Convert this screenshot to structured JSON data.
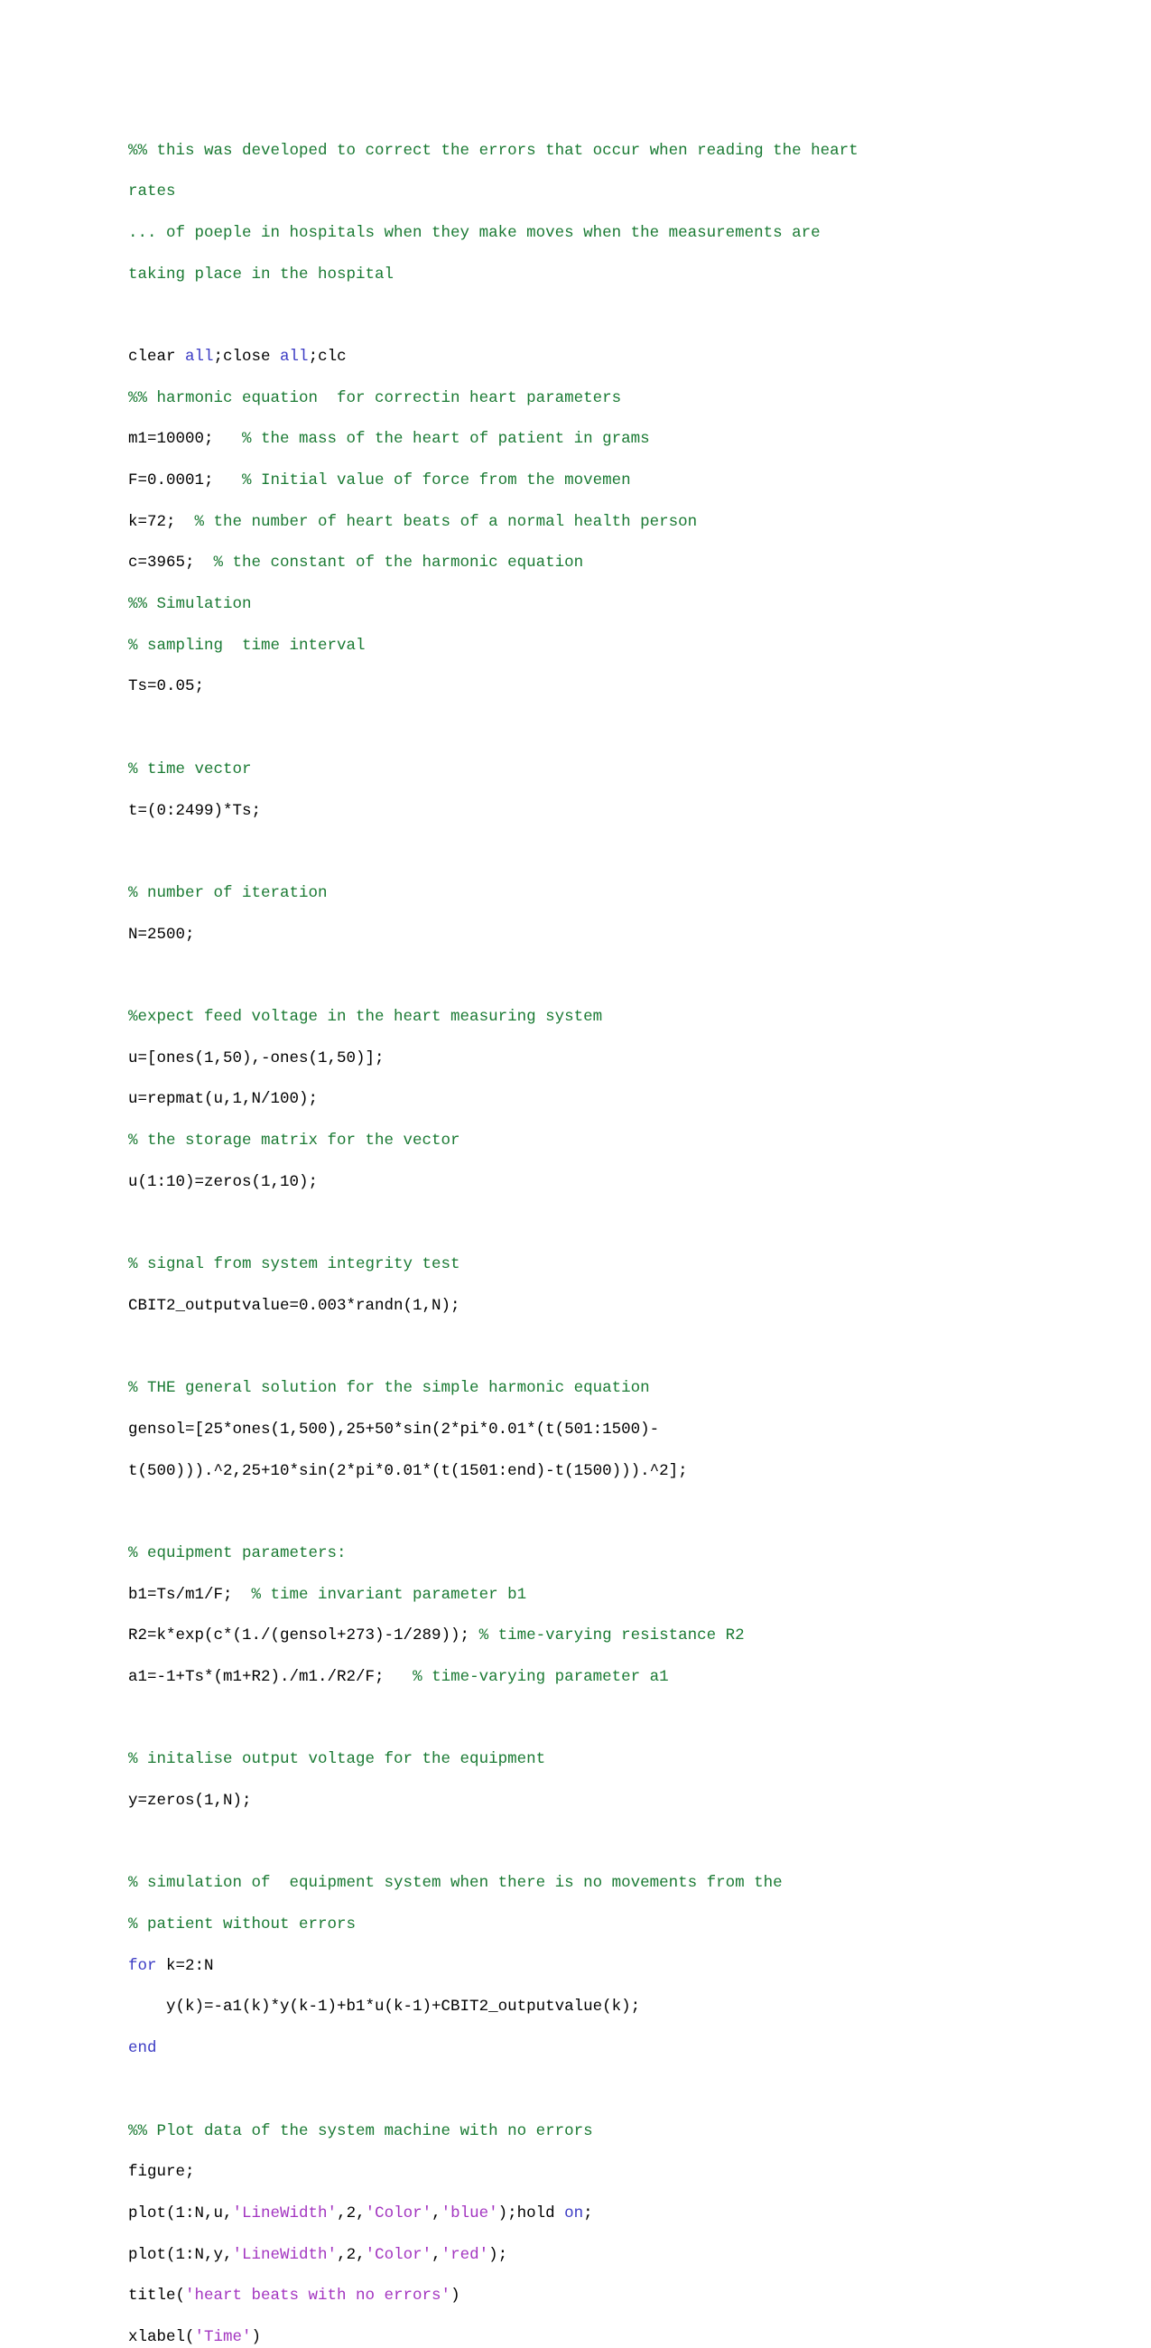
{
  "document": {
    "type": "matlab-source-listing",
    "language": "MATLAB",
    "colors": {
      "background": "#ffffff",
      "plain_text": "#000000",
      "comment": "#1a7a33",
      "keyword": "#3b3bc4",
      "string": "#a335c0"
    }
  },
  "code": {
    "lines": [
      {
        "id": "l1",
        "segments": [
          {
            "cls": "cmt",
            "t": "%% this was developed to correct the errors that occur when reading the heart"
          }
        ]
      },
      {
        "id": "l2",
        "segments": [
          {
            "cls": "cmt",
            "t": "rates"
          }
        ]
      },
      {
        "id": "l3",
        "segments": [
          {
            "cls": "cmt",
            "t": "... of poeple in hospitals when they make moves when the measurements are"
          }
        ]
      },
      {
        "id": "l4",
        "segments": [
          {
            "cls": "cmt",
            "t": "taking place in the hospital"
          }
        ]
      },
      {
        "id": "l5",
        "segments": [
          {
            "cls": "pln",
            "t": ""
          }
        ]
      },
      {
        "id": "l6",
        "segments": [
          {
            "cls": "pln",
            "t": "clear "
          },
          {
            "cls": "kw",
            "t": "all"
          },
          {
            "cls": "pln",
            "t": ";close "
          },
          {
            "cls": "kw",
            "t": "all"
          },
          {
            "cls": "pln",
            "t": ";clc"
          }
        ]
      },
      {
        "id": "l7",
        "segments": [
          {
            "cls": "cmt",
            "t": "%% harmonic equation  for correctin heart parameters"
          }
        ]
      },
      {
        "id": "l8",
        "segments": [
          {
            "cls": "pln",
            "t": "m1=10000;   "
          },
          {
            "cls": "cmt",
            "t": "% the mass of the heart of patient in grams"
          }
        ]
      },
      {
        "id": "l9",
        "segments": [
          {
            "cls": "pln",
            "t": "F=0.0001;   "
          },
          {
            "cls": "cmt",
            "t": "% Initial value of force from the movemen"
          }
        ]
      },
      {
        "id": "l10",
        "segments": [
          {
            "cls": "pln",
            "t": "k=72;  "
          },
          {
            "cls": "cmt",
            "t": "% the number of heart beats of a normal health person"
          }
        ]
      },
      {
        "id": "l11",
        "segments": [
          {
            "cls": "pln",
            "t": "c=3965;  "
          },
          {
            "cls": "cmt",
            "t": "% the constant of the harmonic equation"
          }
        ]
      },
      {
        "id": "l12",
        "segments": [
          {
            "cls": "cmt",
            "t": "%% Simulation"
          }
        ]
      },
      {
        "id": "l13",
        "segments": [
          {
            "cls": "cmt",
            "t": "% sampling  time interval"
          }
        ]
      },
      {
        "id": "l14",
        "segments": [
          {
            "cls": "pln",
            "t": "Ts=0.05;"
          }
        ]
      },
      {
        "id": "l15",
        "segments": [
          {
            "cls": "pln",
            "t": ""
          }
        ]
      },
      {
        "id": "l16",
        "segments": [
          {
            "cls": "cmt",
            "t": "% time vector"
          }
        ]
      },
      {
        "id": "l17",
        "segments": [
          {
            "cls": "pln",
            "t": "t=(0:2499)*Ts;"
          }
        ]
      },
      {
        "id": "l18",
        "segments": [
          {
            "cls": "pln",
            "t": ""
          }
        ]
      },
      {
        "id": "l19",
        "segments": [
          {
            "cls": "cmt",
            "t": "% number of iteration"
          }
        ]
      },
      {
        "id": "l20",
        "segments": [
          {
            "cls": "pln",
            "t": "N=2500;"
          }
        ]
      },
      {
        "id": "l21",
        "segments": [
          {
            "cls": "pln",
            "t": ""
          }
        ]
      },
      {
        "id": "l22",
        "segments": [
          {
            "cls": "cmt",
            "t": "%expect feed voltage in the heart measuring system"
          }
        ]
      },
      {
        "id": "l23",
        "segments": [
          {
            "cls": "pln",
            "t": "u=[ones(1,50),-ones(1,50)];"
          }
        ]
      },
      {
        "id": "l24",
        "segments": [
          {
            "cls": "pln",
            "t": "u=repmat(u,1,N/100);"
          }
        ]
      },
      {
        "id": "l25",
        "segments": [
          {
            "cls": "cmt",
            "t": "% the storage matrix for the vector"
          }
        ]
      },
      {
        "id": "l26",
        "segments": [
          {
            "cls": "pln",
            "t": "u(1:10)=zeros(1,10);"
          }
        ]
      },
      {
        "id": "l27",
        "segments": [
          {
            "cls": "pln",
            "t": ""
          }
        ]
      },
      {
        "id": "l28",
        "segments": [
          {
            "cls": "cmt",
            "t": "% signal from system integrity test"
          }
        ]
      },
      {
        "id": "l29",
        "segments": [
          {
            "cls": "pln",
            "t": "CBIT2_outputvalue=0.003*randn(1,N);"
          }
        ]
      },
      {
        "id": "l30",
        "segments": [
          {
            "cls": "pln",
            "t": ""
          }
        ]
      },
      {
        "id": "l31",
        "segments": [
          {
            "cls": "cmt",
            "t": "% THE general solution for the simple harmonic equation"
          }
        ]
      },
      {
        "id": "l32",
        "segments": [
          {
            "cls": "pln",
            "t": "gensol=[25*ones(1,500),25+50*sin(2*pi*0.01*(t(501:1500)-"
          }
        ]
      },
      {
        "id": "l33",
        "segments": [
          {
            "cls": "pln",
            "t": "t(500))).^2,25+10*sin(2*pi*0.01*(t(1501:end)-t(1500))).^2];"
          }
        ]
      },
      {
        "id": "l34",
        "segments": [
          {
            "cls": "pln",
            "t": ""
          }
        ]
      },
      {
        "id": "l35",
        "segments": [
          {
            "cls": "cmt",
            "t": "% equipment parameters:"
          }
        ]
      },
      {
        "id": "l36",
        "segments": [
          {
            "cls": "pln",
            "t": "b1=Ts/m1/F;  "
          },
          {
            "cls": "cmt",
            "t": "% time invariant parameter b1"
          }
        ]
      },
      {
        "id": "l37",
        "segments": [
          {
            "cls": "pln",
            "t": "R2=k*exp(c*(1./(gensol+273)-1/289)); "
          },
          {
            "cls": "cmt",
            "t": "% time-varying resistance R2"
          }
        ]
      },
      {
        "id": "l38",
        "segments": [
          {
            "cls": "pln",
            "t": "a1=-1+Ts*(m1+R2)./m1./R2/F;   "
          },
          {
            "cls": "cmt",
            "t": "% time-varying parameter a1"
          }
        ]
      },
      {
        "id": "l39",
        "segments": [
          {
            "cls": "pln",
            "t": ""
          }
        ]
      },
      {
        "id": "l40",
        "segments": [
          {
            "cls": "cmt",
            "t": "% initalise output voltage for the equipment"
          }
        ]
      },
      {
        "id": "l41",
        "segments": [
          {
            "cls": "pln",
            "t": "y=zeros(1,N);"
          }
        ]
      },
      {
        "id": "l42",
        "segments": [
          {
            "cls": "pln",
            "t": ""
          }
        ]
      },
      {
        "id": "l43",
        "segments": [
          {
            "cls": "cmt",
            "t": "% simulation of  equipment system when there is no movements from the"
          }
        ]
      },
      {
        "id": "l44",
        "segments": [
          {
            "cls": "cmt",
            "t": "% patient without errors"
          }
        ]
      },
      {
        "id": "l45",
        "segments": [
          {
            "cls": "kw",
            "t": "for"
          },
          {
            "cls": "pln",
            "t": " k=2:N"
          }
        ]
      },
      {
        "id": "l46",
        "segments": [
          {
            "cls": "pln",
            "t": "    y(k)=-a1(k)*y(k-1)+b1*u(k-1)+CBIT2_outputvalue(k);"
          }
        ]
      },
      {
        "id": "l47",
        "segments": [
          {
            "cls": "kw",
            "t": "end"
          }
        ]
      },
      {
        "id": "l48",
        "segments": [
          {
            "cls": "pln",
            "t": ""
          }
        ]
      },
      {
        "id": "l49",
        "segments": [
          {
            "cls": "cmt",
            "t": "%% Plot data of the system machine with no errors"
          }
        ]
      },
      {
        "id": "l50",
        "segments": [
          {
            "cls": "pln",
            "t": "figure;"
          }
        ]
      },
      {
        "id": "l51",
        "segments": [
          {
            "cls": "pln",
            "t": "plot(1:N,u,"
          },
          {
            "cls": "str",
            "t": "'LineWidth'"
          },
          {
            "cls": "pln",
            "t": ",2,"
          },
          {
            "cls": "str",
            "t": "'Color'"
          },
          {
            "cls": "pln",
            "t": ","
          },
          {
            "cls": "str",
            "t": "'blue'"
          },
          {
            "cls": "pln",
            "t": ");hold "
          },
          {
            "cls": "kw",
            "t": "on"
          },
          {
            "cls": "pln",
            "t": ";"
          }
        ]
      },
      {
        "id": "l52",
        "segments": [
          {
            "cls": "pln",
            "t": "plot(1:N,y,"
          },
          {
            "cls": "str",
            "t": "'LineWidth'"
          },
          {
            "cls": "pln",
            "t": ",2,"
          },
          {
            "cls": "str",
            "t": "'Color'"
          },
          {
            "cls": "pln",
            "t": ","
          },
          {
            "cls": "str",
            "t": "'red'"
          },
          {
            "cls": "pln",
            "t": ");"
          }
        ]
      },
      {
        "id": "l53",
        "segments": [
          {
            "cls": "pln",
            "t": "title("
          },
          {
            "cls": "str",
            "t": "'heart beats with no errors'"
          },
          {
            "cls": "pln",
            "t": ")"
          }
        ]
      },
      {
        "id": "l54",
        "segments": [
          {
            "cls": "pln",
            "t": "xlabel("
          },
          {
            "cls": "str",
            "t": "'Time'"
          },
          {
            "cls": "pln",
            "t": ")"
          }
        ]
      }
    ]
  }
}
